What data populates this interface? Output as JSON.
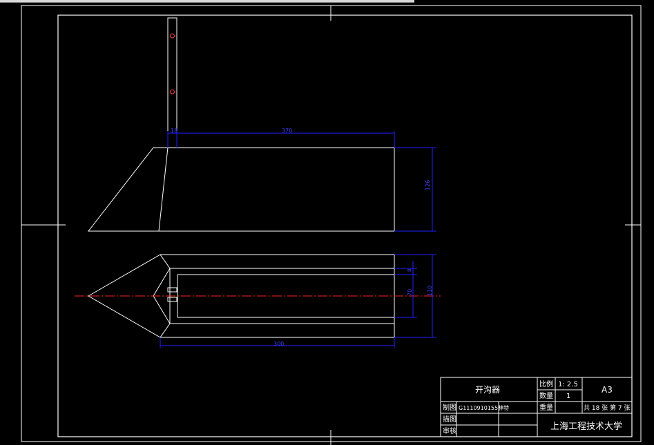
{
  "drawing": {
    "top_dimension": "370",
    "right_dimension_side": "126",
    "bottom_dimension": "300",
    "right_outer_dimension": "110",
    "right_inner_dimension": "70",
    "small_dimension": "8",
    "top_small_dimension": "18"
  },
  "title_block": {
    "part_name": "开沟器",
    "scale_label": "比例",
    "scale_value": "1: 2.5",
    "quantity_label": "数量",
    "quantity_value": "1",
    "weight_label": "重量",
    "paper_size": "A3",
    "sheet_info": "共 18 张 第 7 张",
    "drawn_by_label": "制图",
    "drawn_by_value": "G1110910155林特",
    "drafted_label": "描图",
    "reviewed_label": "审核",
    "school": "上海工程技术大学"
  },
  "colors": {
    "background": "#000000",
    "line": "#ffffff",
    "dimension": "#2020ff",
    "centerline": "#ff2020"
  }
}
